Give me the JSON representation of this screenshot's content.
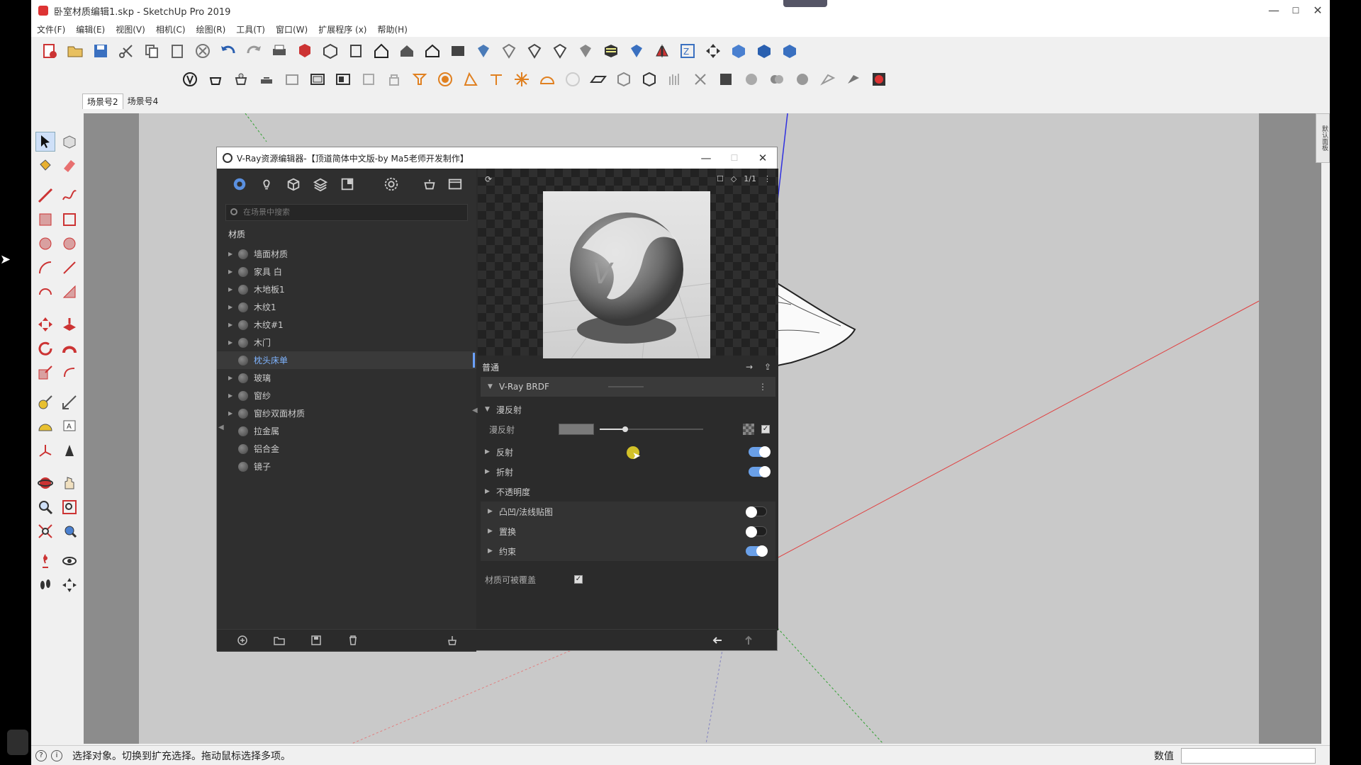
{
  "window": {
    "title": "卧室材质编辑1.skp - SketchUp Pro 2019",
    "minimize": "—",
    "maximize": "☐",
    "close": "✕"
  },
  "menu": [
    "文件(F)",
    "编辑(E)",
    "视图(V)",
    "相机(C)",
    "绘图(R)",
    "工具(T)",
    "窗口(W)",
    "扩展程序 (x)",
    "帮助(H)"
  ],
  "scenes": [
    "场景号2",
    "场景号4"
  ],
  "right_panel_label": "默认面板",
  "statusbar": {
    "message": "选择对象。切换到扩充选择。拖动鼠标选择多项。",
    "value_label": "数值",
    "value": ""
  },
  "vray": {
    "title": "V-Ray资源编辑器-【顶道简体中文版-by Ma5老师开发制作】",
    "minimize": "—",
    "maximize": "☐",
    "close": "✕",
    "search_placeholder": "在场景中搜索",
    "materials_label": "材质",
    "materials": [
      {
        "name": "墙面材质",
        "expandable": true
      },
      {
        "name": "家具 白",
        "expandable": true
      },
      {
        "name": "木地板1",
        "expandable": true
      },
      {
        "name": "木纹1",
        "expandable": true
      },
      {
        "name": "木纹#1",
        "expandable": true
      },
      {
        "name": "木门",
        "expandable": true
      },
      {
        "name": "枕头床单",
        "expandable": false,
        "selected": true
      },
      {
        "name": "玻璃",
        "expandable": true
      },
      {
        "name": "窗纱",
        "expandable": true
      },
      {
        "name": "窗纱双面材质",
        "expandable": true
      },
      {
        "name": "拉金属",
        "expandable": false
      },
      {
        "name": "铝合金",
        "expandable": false
      },
      {
        "name": "镜子",
        "expandable": false
      }
    ],
    "preview_ratio": "1/1",
    "params": {
      "general_label": "普通",
      "brdf_label": "V-Ray BRDF",
      "diffuse_section": "漫反射",
      "diffuse_label": "漫反射",
      "diffuse_color": "#7a7a7a",
      "sections": [
        {
          "label": "反射",
          "toggle": true
        },
        {
          "label": "折射",
          "toggle": true
        },
        {
          "label": "不透明度",
          "toggle": null
        },
        {
          "label": "凸凹/法线贴图",
          "toggle": false
        },
        {
          "label": "置换",
          "toggle": false
        },
        {
          "label": "约束",
          "toggle": true
        }
      ],
      "overridable_label": "材质可被覆盖",
      "overridable": true
    }
  },
  "colors": {
    "accent": "#6aa0e8",
    "selected_text": "#7fb4ff",
    "dialog_bg": "#2b2b2b",
    "viewport_bg": "#c9c9c9"
  }
}
